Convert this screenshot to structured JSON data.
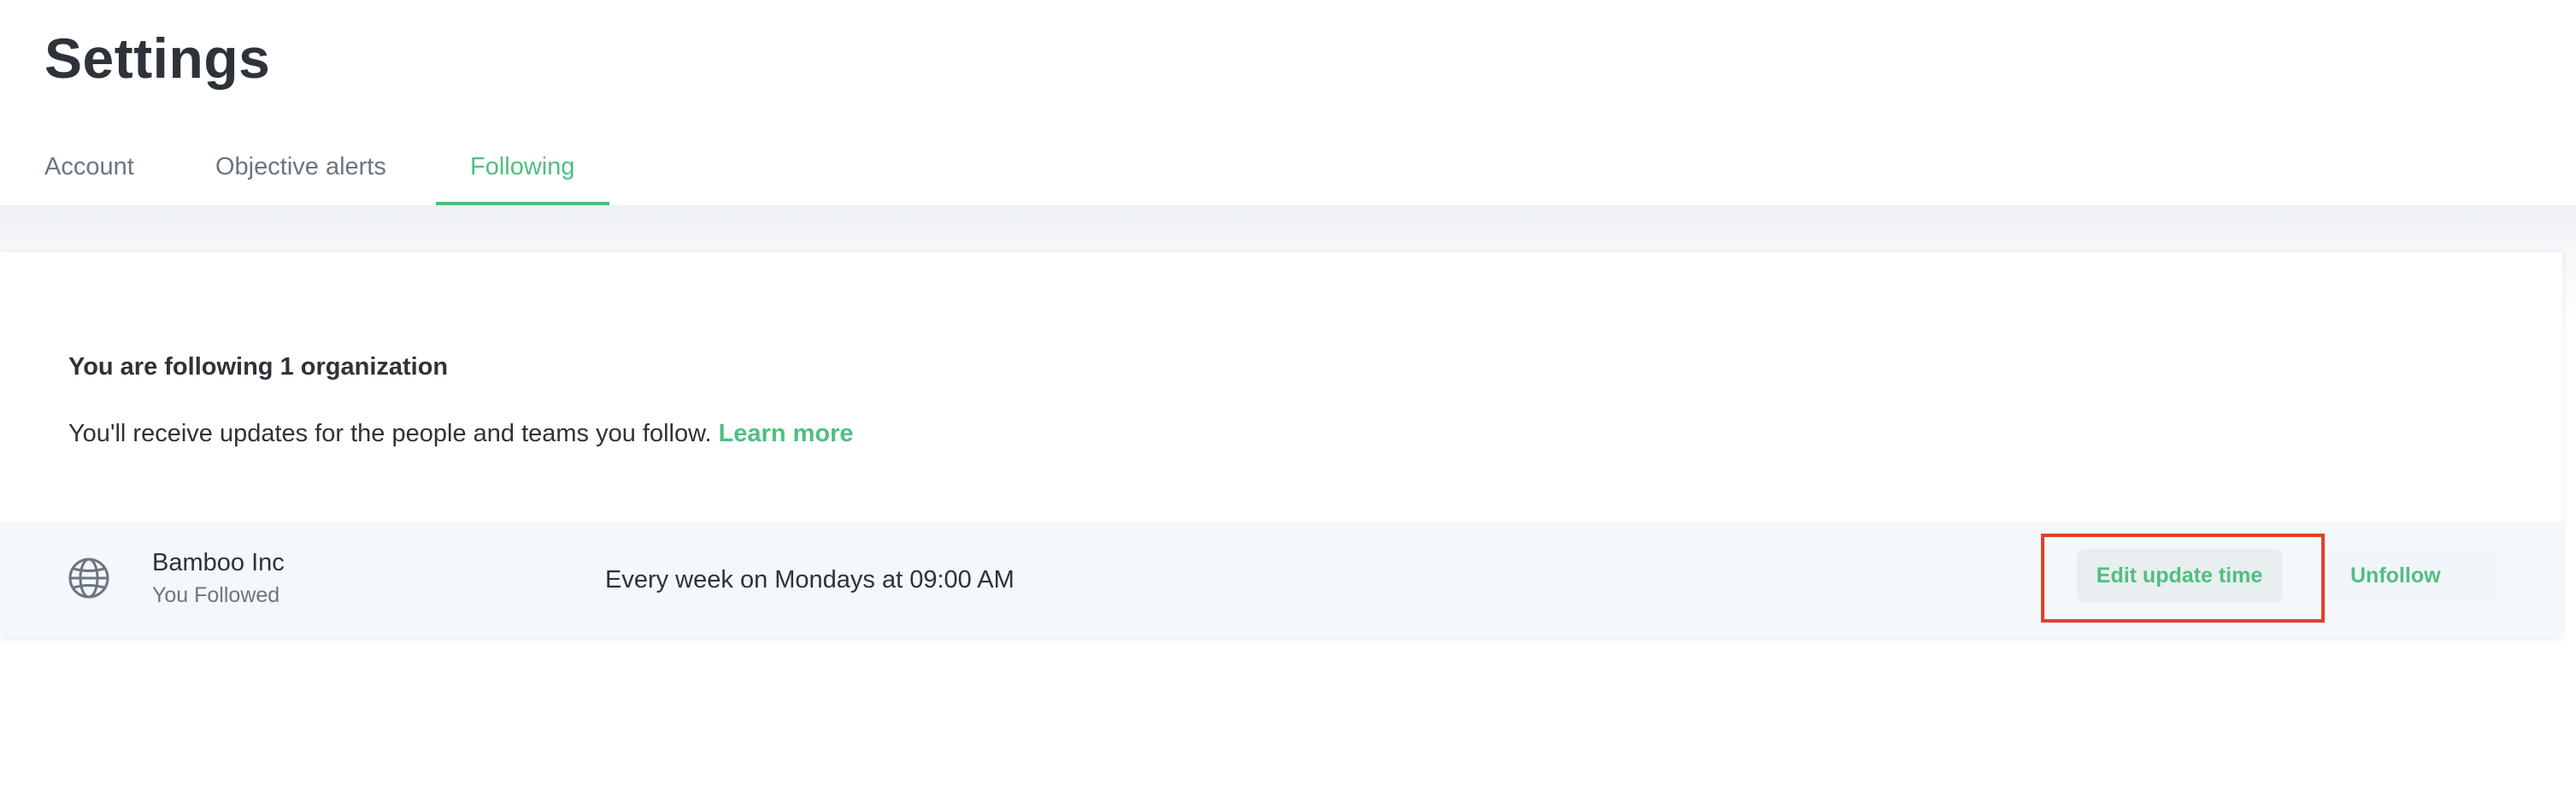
{
  "page": {
    "title": "Settings"
  },
  "tabs": [
    {
      "label": "Account",
      "active": false
    },
    {
      "label": "Objective alerts",
      "active": false
    },
    {
      "label": "Following",
      "active": true
    }
  ],
  "following": {
    "heading": "You are following 1 organization",
    "description": "You'll receive updates for the people and teams you follow.",
    "learn_more": "Learn more",
    "items": [
      {
        "icon": "globe-icon",
        "name": "Bamboo Inc",
        "subtitle": "You Followed",
        "schedule": "Every week on Mondays at 09:00 AM",
        "edit_label": "Edit update time",
        "unfollow_label": "Unfollow"
      }
    ]
  },
  "colors": {
    "accent": "#4fbf80",
    "text": "#2d3338",
    "muted": "#6b7680",
    "highlight": "#e0402a",
    "row_bg": "#f4f7fb"
  }
}
